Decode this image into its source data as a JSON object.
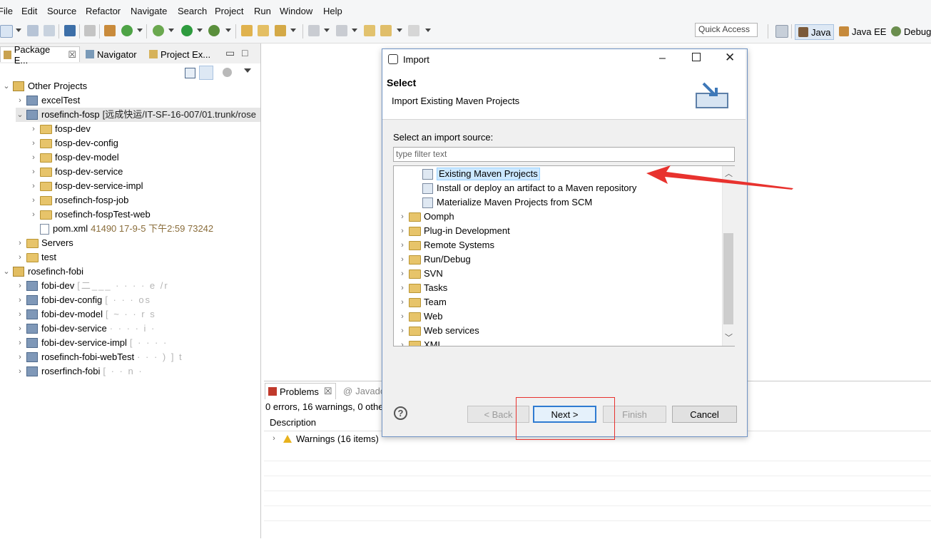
{
  "menu": [
    "File",
    "Edit",
    "Source",
    "Refactor",
    "Navigate",
    "Search",
    "Project",
    "Run",
    "Window",
    "Help"
  ],
  "toolbar": {
    "quick_access": "Quick Access",
    "perspectives": [
      "Java",
      "Java EE",
      "Debug"
    ]
  },
  "left_view": {
    "tabs": [
      "Package E...",
      "Navigator",
      "Project Ex..."
    ],
    "tree": [
      {
        "label": "Other Projects",
        "level": 0,
        "expanded": true,
        "icon": "working-set"
      },
      {
        "label": "excelTest",
        "level": 1,
        "expanded": false,
        "icon": "project"
      },
      {
        "label": "rosefinch-fosp",
        "meta": "[远成快运/IT-SF-16-007/01.trunk/rose",
        "level": 1,
        "expanded": true,
        "icon": "project",
        "selected": true
      },
      {
        "label": "fosp-dev",
        "level": 2,
        "expanded": false,
        "icon": "folder"
      },
      {
        "label": "fosp-dev-config",
        "level": 2,
        "expanded": false,
        "icon": "folder"
      },
      {
        "label": "fosp-dev-model",
        "level": 2,
        "expanded": false,
        "icon": "folder"
      },
      {
        "label": "fosp-dev-service",
        "level": 2,
        "expanded": false,
        "icon": "folder"
      },
      {
        "label": "fosp-dev-service-impl",
        "level": 2,
        "expanded": false,
        "icon": "folder"
      },
      {
        "label": "rosefinch-fosp-job",
        "level": 2,
        "expanded": false,
        "icon": "folder"
      },
      {
        "label": "rosefinch-fospTest-web",
        "level": 2,
        "expanded": false,
        "icon": "folder"
      },
      {
        "label": "pom.xml",
        "meta": "41490  17-9-5 下午2:59  73242",
        "level": 2,
        "leaf": true,
        "icon": "file"
      },
      {
        "label": "Servers",
        "level": 1,
        "expanded": false,
        "icon": "folder"
      },
      {
        "label": "test",
        "level": 1,
        "expanded": false,
        "icon": "folder"
      },
      {
        "label": "rosefinch-fobi",
        "level": 0,
        "expanded": true,
        "icon": "working-set"
      },
      {
        "label": "fobi-dev",
        "blur": "[二___  · · ·   ·   e    /r",
        "level": 1,
        "expanded": false,
        "icon": "project"
      },
      {
        "label": "fobi-dev-config",
        "blur": "[   ·    ·   · os",
        "level": 1,
        "expanded": false,
        "icon": "project"
      },
      {
        "label": "fobi-dev-model",
        "blur": "[ ~    ·   ·   r s",
        "level": 1,
        "expanded": false,
        "icon": "project"
      },
      {
        "label": "fobi-dev-service",
        "blur": "·   ·   ·  · i ·",
        "level": 1,
        "expanded": false,
        "icon": "project"
      },
      {
        "label": "fobi-dev-service-impl",
        "blur": "[ ·  ·   ·  ·",
        "level": 1,
        "expanded": false,
        "icon": "project"
      },
      {
        "label": "rosefinch-fobi-webTest",
        "blur": "·   ·   ·   )  ]  t",
        "level": 1,
        "expanded": false,
        "icon": "project"
      },
      {
        "label": "roserfinch-fobi",
        "blur": "[   ·  ·   n  ·",
        "level": 1,
        "expanded": false,
        "icon": "project"
      }
    ]
  },
  "problems": {
    "tab_label": "Problems",
    "other_tab": "Javado",
    "summary": "0 errors, 16 warnings, 0 othe",
    "column": "Description",
    "warnings": "Warnings (16 items)"
  },
  "dialog": {
    "title": "Import",
    "header_title": "Select",
    "header_desc": "Import Existing Maven Projects",
    "source_label": "Select an import source:",
    "filter_placeholder": "type filter text",
    "items": [
      {
        "label": "Existing Maven Projects",
        "level": 2,
        "leaf": true,
        "selected": true
      },
      {
        "label": "Install or deploy an artifact to a Maven repository",
        "level": 2,
        "leaf": true
      },
      {
        "label": "Materialize Maven Projects from SCM",
        "level": 2,
        "leaf": true
      },
      {
        "label": "Oomph",
        "level": 1
      },
      {
        "label": "Plug-in Development",
        "level": 1
      },
      {
        "label": "Remote Systems",
        "level": 1
      },
      {
        "label": "Run/Debug",
        "level": 1
      },
      {
        "label": "SVN",
        "level": 1
      },
      {
        "label": "Tasks",
        "level": 1
      },
      {
        "label": "Team",
        "level": 1
      },
      {
        "label": "Web",
        "level": 1
      },
      {
        "label": "Web services",
        "level": 1
      },
      {
        "label": "XML",
        "level": 1
      }
    ],
    "buttons": {
      "back": "< Back",
      "next": "Next >",
      "finish": "Finish",
      "cancel": "Cancel"
    }
  },
  "colors": {
    "annotation": "#e8322e",
    "selection": "#cce8ff",
    "accent": "#2f7bd1"
  }
}
